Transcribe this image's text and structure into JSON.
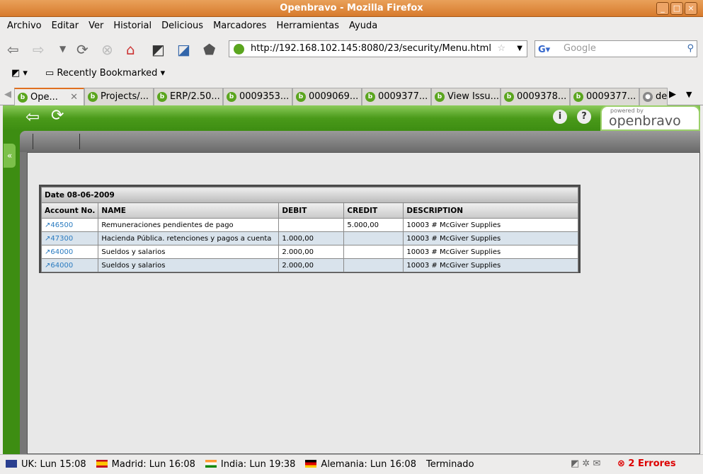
{
  "window": {
    "title": "Openbravo - Mozilla Firefox"
  },
  "menu": [
    "Archivo",
    "Editar",
    "Ver",
    "Historial",
    "Delicious",
    "Marcadores",
    "Herramientas",
    "Ayuda"
  ],
  "url": "http://192.168.102.145:8080/23/security/Menu.html",
  "search_placeholder": "Google",
  "bookmarks": {
    "recent": "Recently Bookmarked"
  },
  "tabs": [
    "Ope...",
    "Projects/...",
    "ERP/2.50...",
    "0009353...",
    "0009069...",
    "0009377...",
    "View Issu...",
    "0009378...",
    "0009377...",
    "de"
  ],
  "logo": {
    "powered": "powered by",
    "brand": "openbravo"
  },
  "report": {
    "date": "Date 08-06-2009",
    "columns": [
      "Account No.",
      "NAME",
      "DEBIT",
      "CREDIT",
      "DESCRIPTION"
    ],
    "rows": [
      {
        "account": "46500",
        "name": "Remuneraciones pendientes de pago",
        "debit": "",
        "credit": "5.000,00",
        "description": "10003 # McGiver Supplies"
      },
      {
        "account": "47300",
        "name": "Hacienda Pública. retenciones y pagos a cuenta",
        "debit": "1.000,00",
        "credit": "",
        "description": "10003 # McGiver Supplies"
      },
      {
        "account": "64000",
        "name": "Sueldos y salarios",
        "debit": "2.000,00",
        "credit": "",
        "description": "10003 # McGiver Supplies"
      },
      {
        "account": "64000",
        "name": "Sueldos y salarios",
        "debit": "2.000,00",
        "credit": "",
        "description": "10003 # McGiver Supplies"
      }
    ]
  },
  "status": {
    "clocks": [
      "UK: Lun 15:08",
      "Madrid: Lun 16:08",
      "India: Lun 19:38",
      "Alemania: Lun 16:08"
    ],
    "state": "Terminado",
    "errors": "2 Errores"
  }
}
